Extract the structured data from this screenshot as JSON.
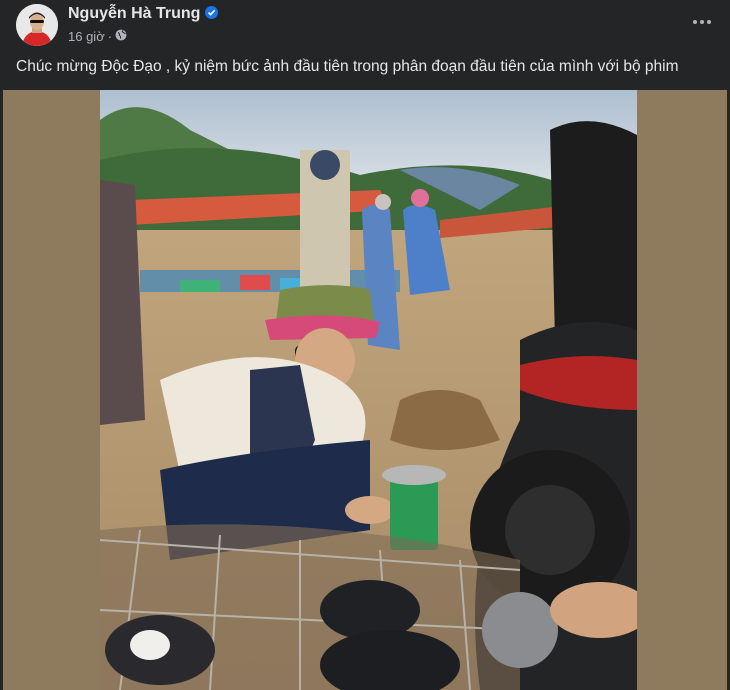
{
  "post": {
    "author_name": "Nguyễn Hà Trung",
    "verified": true,
    "time": "16 giờ",
    "separator": "·",
    "privacy_icon": "globe-icon",
    "more_icon": "more-horizontal-icon",
    "caption": "Chúc mừng Độc Đạo , kỷ niệm bức ảnh đầu tiên trong phân đoạn đầu tiên của mình với bộ phim"
  },
  "colors": {
    "background": "#242526",
    "text_primary": "#e4e6eb",
    "text_secondary": "#b0b3b8",
    "verified_badge": "#1b74e4",
    "photo_side_bars": "#8e7a5c"
  }
}
